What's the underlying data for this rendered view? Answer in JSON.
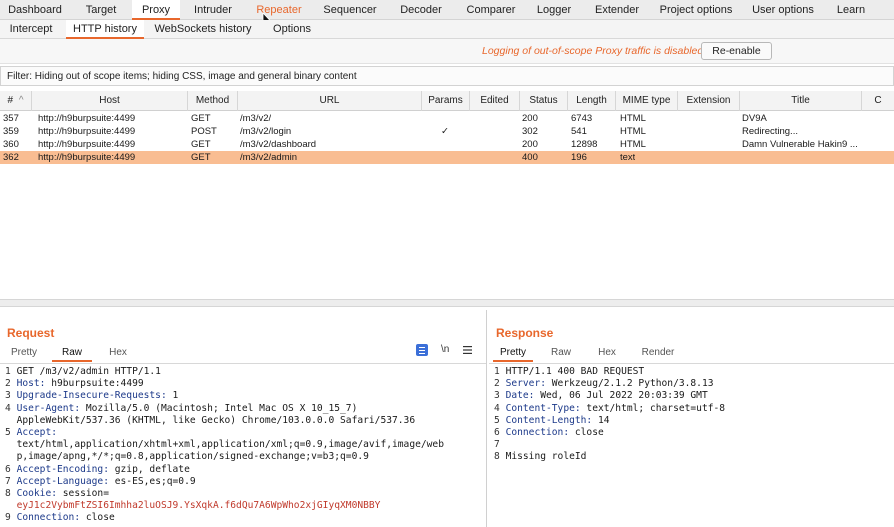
{
  "top_tabs": [
    "Dashboard",
    "Target",
    "Proxy",
    "Intruder",
    "Repeater",
    "Sequencer",
    "Decoder",
    "Comparer",
    "Logger",
    "Extender",
    "Project options",
    "User options",
    "Learn"
  ],
  "sub_tabs": [
    "Intercept",
    "HTTP history",
    "WebSockets history",
    "Options"
  ],
  "notice": {
    "text": "Logging of out-of-scope Proxy traffic is disabled",
    "button": "Re-enable"
  },
  "filter": "Filter: Hiding out of scope items;  hiding CSS, image and general binary content",
  "table": {
    "headers": [
      "#",
      "Host",
      "Method",
      "URL",
      "Params",
      "Edited",
      "Status",
      "Length",
      "MIME type",
      "Extension",
      "Title",
      "C"
    ],
    "sort_indicator": "^",
    "rows": [
      {
        "num": "357",
        "host": "http://h9burpsuite:4499",
        "method": "GET",
        "url": "/m3/v2/",
        "params": "",
        "status": "200",
        "length": "6743",
        "mime": "HTML",
        "title": "DV9A"
      },
      {
        "num": "359",
        "host": "http://h9burpsuite:4499",
        "method": "POST",
        "url": "/m3/v2/login",
        "params": "✓",
        "status": "302",
        "length": "541",
        "mime": "HTML",
        "title": "Redirecting..."
      },
      {
        "num": "360",
        "host": "http://h9burpsuite:4499",
        "method": "GET",
        "url": "/m3/v2/dashboard",
        "params": "",
        "status": "200",
        "length": "12898",
        "mime": "HTML",
        "title": "Damn Vulnerable Hakin9 ..."
      },
      {
        "num": "362",
        "host": "http://h9burpsuite:4499",
        "method": "GET",
        "url": "/m3/v2/admin",
        "params": "",
        "status": "400",
        "length": "196",
        "mime": "text",
        "title": ""
      }
    ]
  },
  "request": {
    "title": "Request",
    "tabs": [
      "Pretty",
      "Raw",
      "Hex"
    ],
    "newline_label": "\\n",
    "lines": [
      {
        "n": "1",
        "key": "",
        "val": "GET /m3/v2/admin HTTP/1.1"
      },
      {
        "n": "2",
        "key": "Host:",
        "val": " h9burpsuite:4499"
      },
      {
        "n": "3",
        "key": "Upgrade-Insecure-Requests:",
        "val": " 1"
      },
      {
        "n": "4",
        "key": "User-Agent:",
        "val": " Mozilla/5.0 (Macintosh; Intel Mac OS X 10_15_7)"
      },
      {
        "n": "",
        "key": "",
        "val": "AppleWebKit/537.36 (KHTML, like Gecko) Chrome/103.0.0.0 Safari/537.36"
      },
      {
        "n": "5",
        "key": "Accept:",
        "val": ""
      },
      {
        "n": "",
        "key": "",
        "val": "text/html,application/xhtml+xml,application/xml;q=0.9,image/avif,image/web"
      },
      {
        "n": "",
        "key": "",
        "val": "p,image/apng,*/*;q=0.8,application/signed-exchange;v=b3;q=0.9"
      },
      {
        "n": "6",
        "key": "Accept-Encoding:",
        "val": " gzip, deflate"
      },
      {
        "n": "7",
        "key": "Accept-Language:",
        "val": " es-ES,es;q=0.9"
      },
      {
        "n": "8",
        "key": "Cookie:",
        "val": " session="
      },
      {
        "n": "",
        "key": "",
        "val": "eyJ1c2VybmFtZSI6Imhha2luOSJ9.YsXqkA.f6dQu7A6WpWho2xjGIyqXM0NBBY",
        "cookie": true
      },
      {
        "n": "9",
        "key": "Connection:",
        "val": " close"
      }
    ]
  },
  "response": {
    "title": "Response",
    "tabs": [
      "Pretty",
      "Raw",
      "Hex",
      "Render"
    ],
    "lines": [
      {
        "n": "1",
        "key": "",
        "val": "HTTP/1.1 400 BAD REQUEST"
      },
      {
        "n": "2",
        "key": "Server:",
        "val": " Werkzeug/2.1.2 Python/3.8.13"
      },
      {
        "n": "3",
        "key": "Date:",
        "val": " Wed, 06 Jul 2022 20:03:39 GMT"
      },
      {
        "n": "4",
        "key": "Content-Type:",
        "val": " text/html; charset=utf-8"
      },
      {
        "n": "5",
        "key": "Content-Length:",
        "val": " 14"
      },
      {
        "n": "6",
        "key": "Connection:",
        "val": " close"
      },
      {
        "n": "7",
        "key": "",
        "val": ""
      },
      {
        "n": "8",
        "key": "",
        "val": "Missing roleId"
      }
    ]
  },
  "colors": {
    "accent": "#e8672c",
    "selected_row": "#f9bd92",
    "header_key": "#1d3a8a"
  }
}
